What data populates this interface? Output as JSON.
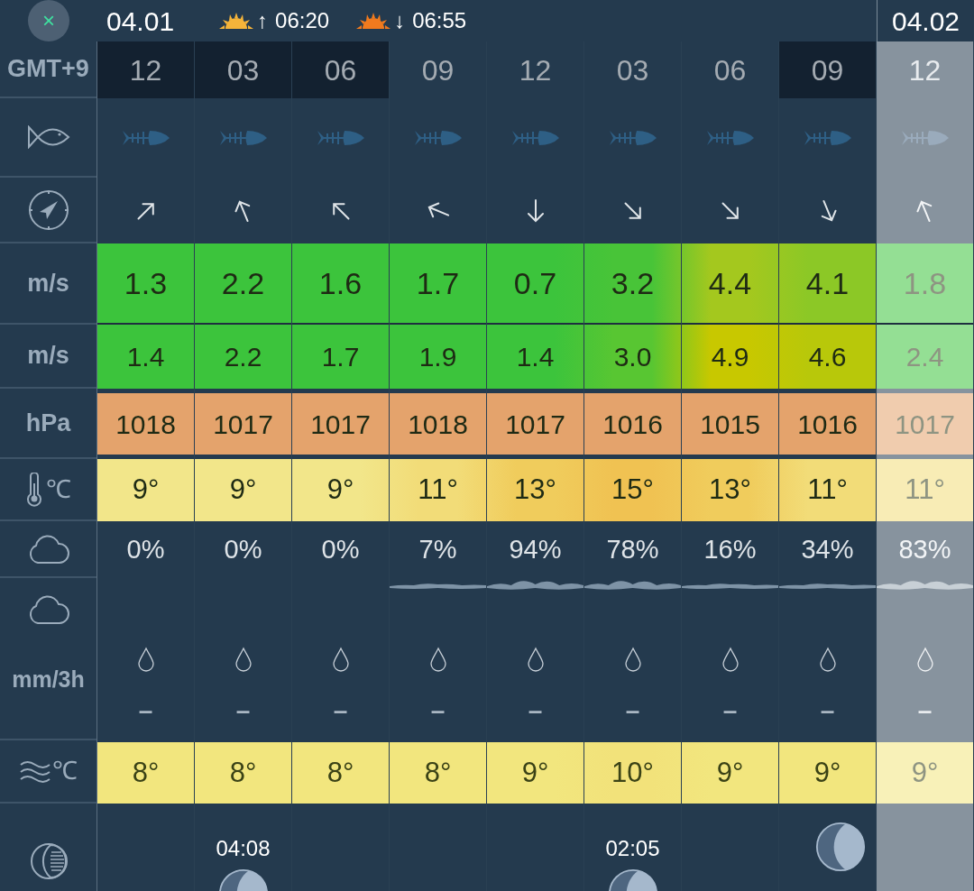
{
  "close_button": {
    "label": "×"
  },
  "header": {
    "date": "04.01",
    "sunrise": {
      "arrow": "↑",
      "time": "06:20"
    },
    "sunset": {
      "arrow": "↓",
      "time": "06:55"
    },
    "next_date": "04.02"
  },
  "labels": {
    "timezone": "GMT+9",
    "wind_unit": "m/s",
    "gust_unit": "m/s",
    "pressure_unit": "hPa",
    "temperature_unit": "℃",
    "precipitation_unit": "mm/3h",
    "water_temperature_unit": "℃"
  },
  "columns": [
    {
      "time": "12",
      "shaded": true,
      "dimmed": false,
      "wind_arrow": {
        "kind": "NE"
      },
      "wind": {
        "value": "1.3",
        "color": "#3cc43c"
      },
      "gust": {
        "value": "1.4",
        "color": "#3cc43c"
      },
      "pressure": "1018",
      "temperature": {
        "value": "9°",
        "color": "#f2e68a"
      },
      "cloud": "0%",
      "high_cloud": {
        "kind": "none"
      },
      "precipitation": "–",
      "water_temperature": {
        "value": "8°",
        "color": "#f2e67e"
      }
    },
    {
      "time": "03",
      "shaded": true,
      "dimmed": false,
      "wind_arrow": {
        "kind": "NNW"
      },
      "wind": {
        "value": "2.2",
        "color": "#3cc43c"
      },
      "gust": {
        "value": "2.2",
        "color": "#3cc43c"
      },
      "pressure": "1017",
      "temperature": {
        "value": "9°",
        "color": "#f2e68a"
      },
      "cloud": "0%",
      "high_cloud": {
        "kind": "none"
      },
      "precipitation": "–",
      "water_temperature": {
        "value": "8°",
        "color": "#f2e67e"
      },
      "moon": {
        "kind": "rise",
        "time": "04:08"
      }
    },
    {
      "time": "06",
      "shaded": true,
      "dimmed": false,
      "wind_arrow": {
        "kind": "NW"
      },
      "wind": {
        "value": "1.6",
        "color": "#3cc43c"
      },
      "gust": {
        "value": "1.7",
        "color": "#3cc43c"
      },
      "pressure": "1017",
      "temperature": {
        "value": "9°",
        "color": "#f2e68a"
      },
      "cloud": "0%",
      "high_cloud": {
        "kind": "none"
      },
      "precipitation": "–",
      "water_temperature": {
        "value": "8°",
        "color": "#f2e67e"
      }
    },
    {
      "time": "09",
      "shaded": false,
      "dimmed": false,
      "wind_arrow": {
        "kind": "WNW"
      },
      "wind": {
        "value": "1.7",
        "color": "#3cc43c"
      },
      "gust": {
        "value": "1.9",
        "color": "#3cc43c"
      },
      "pressure": "1018",
      "temperature": {
        "value": "11°",
        "color": "#f2dc78"
      },
      "cloud": "7%",
      "high_cloud": {
        "kind": "thin"
      },
      "precipitation": "–",
      "water_temperature": {
        "value": "8°",
        "color": "#f2e67e"
      }
    },
    {
      "time": "12",
      "shaded": false,
      "dimmed": false,
      "wind_arrow": {
        "kind": "S"
      },
      "wind": {
        "value": "0.7",
        "color": "#3cc43c"
      },
      "gust": {
        "value": "1.4",
        "color": "#3cc43c"
      },
      "pressure": "1017",
      "temperature": {
        "value": "13°",
        "color": "#f0cc5c"
      },
      "cloud": "94%",
      "high_cloud": {
        "kind": "thick"
      },
      "precipitation": "–",
      "water_temperature": {
        "value": "9°",
        "color": "#f2e67e"
      }
    },
    {
      "time": "03",
      "shaded": false,
      "dimmed": false,
      "wind_arrow": {
        "kind": "SE"
      },
      "wind": {
        "value": "3.2",
        "color": "#48c438"
      },
      "gust": {
        "value": "3.0",
        "color": "#58c632"
      },
      "pressure": "1016",
      "temperature": {
        "value": "15°",
        "color": "#f0c252"
      },
      "cloud": "78%",
      "high_cloud": {
        "kind": "thick"
      },
      "precipitation": "–",
      "water_temperature": {
        "value": "10°",
        "color": "#f2e27a"
      },
      "moon": {
        "kind": "rise",
        "time": "02:05"
      }
    },
    {
      "time": "06",
      "shaded": false,
      "dimmed": false,
      "wind_arrow": {
        "kind": "SE"
      },
      "wind": {
        "value": "4.4",
        "color": "#a4c81e"
      },
      "gust": {
        "value": "4.9",
        "color": "#c8c800"
      },
      "pressure": "1015",
      "temperature": {
        "value": "13°",
        "color": "#f0cc5c"
      },
      "cloud": "16%",
      "high_cloud": {
        "kind": "thin"
      },
      "precipitation": "–",
      "water_temperature": {
        "value": "9°",
        "color": "#f2e67e"
      }
    },
    {
      "time": "09",
      "shaded": true,
      "dimmed": false,
      "wind_arrow": {
        "kind": "SSE"
      },
      "wind": {
        "value": "4.1",
        "color": "#8cc826"
      },
      "gust": {
        "value": "4.6",
        "color": "#b8c80a"
      },
      "pressure": "1016",
      "temperature": {
        "value": "11°",
        "color": "#f2dc78"
      },
      "cloud": "34%",
      "high_cloud": {
        "kind": "thin"
      },
      "precipitation": "–",
      "water_temperature": {
        "value": "9°",
        "color": "#f2e67e"
      },
      "moon": {
        "kind": "full"
      }
    },
    {
      "time": "12",
      "shaded": false,
      "dimmed": true,
      "wind_arrow": {
        "kind": "NNW"
      },
      "wind": {
        "value": "1.8",
        "color": "#94df94"
      },
      "gust": {
        "value": "2.4",
        "color": "#94df94"
      },
      "pressure": "1017",
      "temperature": {
        "value": "11°",
        "color": "#f8ecb5"
      },
      "cloud": "83%",
      "high_cloud": {
        "kind": "thick"
      },
      "precipitation": "–",
      "water_temperature": {
        "value": "9°",
        "color": "#f8f1b8"
      }
    }
  ]
}
